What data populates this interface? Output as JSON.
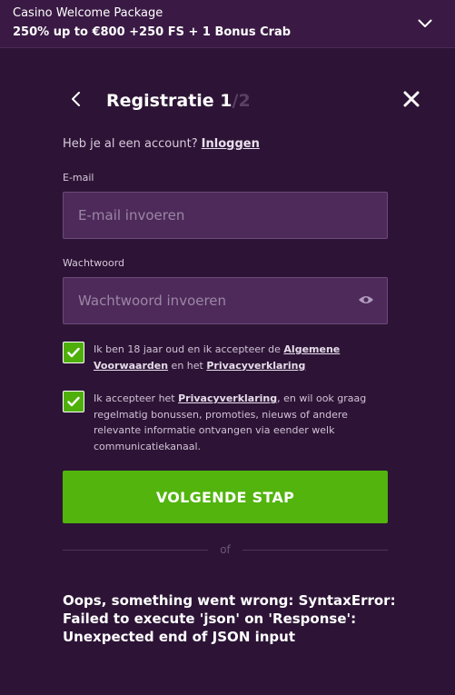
{
  "promo": {
    "title": "Casino Welcome Package",
    "subtitle": "250% up to €800 +250 FS + 1 Bonus Crab",
    "toggle_icon": "chevron-down-icon"
  },
  "header": {
    "back_icon": "chevron-left-icon",
    "title": "Registratie 1",
    "step_total": "/2",
    "close_icon": "close-icon"
  },
  "account": {
    "prompt": "Heb je al een account?",
    "login_label": "Inloggen"
  },
  "email": {
    "label": "E-mail",
    "placeholder": "E-mail invoeren",
    "value": ""
  },
  "password": {
    "label": "Wachtwoord",
    "placeholder": "Wachtwoord invoeren",
    "value": "",
    "toggle_icon": "eye-icon"
  },
  "consents": [
    {
      "checked": true,
      "text_before": "Ik ben 18 jaar oud en ik accepteer de ",
      "link1": "Algemene Voorwaarden",
      "text_middle": " en het ",
      "link2": "Privacyverklaring",
      "text_after": ""
    },
    {
      "checked": true,
      "text_before": "Ik accepteer het ",
      "link1": "Privacyverklaring",
      "text_middle": ", en wil ook graag regelmatig bonussen, promoties, nieuws of andere relevante informatie ontvangen via eender welk communicatiekanaal.",
      "link2": "",
      "text_after": ""
    }
  ],
  "next_button": {
    "label": "VOLGENDE STAP"
  },
  "divider": {
    "label": "of"
  },
  "error": {
    "message": "Oops, something went wrong: SyntaxError: Failed to execute 'json' on 'Response': Unexpected end of JSON input"
  },
  "colors": {
    "background": "#2d1436",
    "field_background": "#4e2a5b",
    "accent_green": "#52b40d",
    "checkbox_green": "#4eaf0a"
  }
}
